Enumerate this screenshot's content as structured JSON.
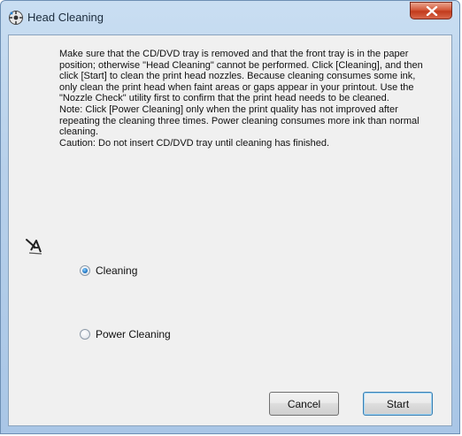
{
  "window": {
    "title": "Head Cleaning",
    "close_label": "x"
  },
  "description": {
    "paragraph1": "Make sure that the CD/DVD tray is removed and that the front tray is in the paper position; otherwise \"Head Cleaning\" cannot be performed. Click [Cleaning], and then click [Start] to clean the print head nozzles. Because cleaning consumes some ink, only clean the print head when faint areas or gaps appear in your printout. Use the \"Nozzle Check\" utility first to confirm that the print head needs to be cleaned.",
    "note": "Note: Click [Power Cleaning] only when the print quality has not improved after repeating the cleaning three times. Power cleaning consumes more ink than normal cleaning.",
    "caution": "Caution: Do not insert CD/DVD tray until cleaning has finished."
  },
  "options": {
    "selected": "Cleaning",
    "items": [
      {
        "label": "Cleaning",
        "checked": true
      },
      {
        "label": "Power Cleaning",
        "checked": false
      }
    ]
  },
  "buttons": {
    "cancel_label": "Cancel",
    "start_label": "Start"
  },
  "icons": {
    "title_icon": "printer-head-icon",
    "head_icon": "print-head-icon",
    "close_icon": "close-icon"
  },
  "colors": {
    "titlebar": "#b7d0ea",
    "close_button": "#c23b1c",
    "client_bg": "#f0f0f0",
    "radio_dot": "#2a7fc9"
  }
}
